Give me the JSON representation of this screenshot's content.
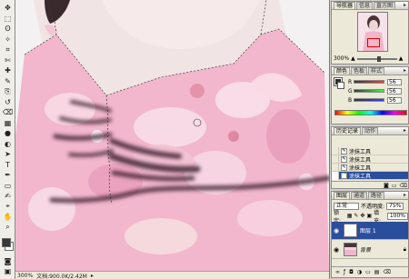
{
  "colors": {
    "panel_bg": "#ece9d8",
    "selection_blue": "#2a4d9c",
    "dress_pink": "#f2b7cc",
    "stroke_dark": "#3f2432"
  },
  "tools": [
    "move-tool",
    "marquee-tool",
    "lasso-tool",
    "magic-wand-tool",
    "crop-tool",
    "slice-tool",
    "healing-brush-tool",
    "brush-tool",
    "clone-stamp-tool",
    "history-brush-tool",
    "eraser-tool",
    "gradient-tool",
    "blur-tool",
    "dodge-tool",
    "path-selection-tool",
    "type-tool",
    "pen-tool",
    "shape-tool",
    "notes-tool",
    "eyedropper-tool",
    "hand-tool",
    "zoom-tool"
  ],
  "tool_glyphs": [
    "✥",
    "⬚",
    "ʘ",
    "✧",
    "⌗",
    "✄",
    "✚",
    "✎",
    "⎘",
    "↺",
    "⌫",
    "▦",
    "●",
    "◐",
    "➤",
    "T",
    "✒",
    "▭",
    "✍",
    "⌖",
    "✋",
    "⌕"
  ],
  "navigator": {
    "tabs": [
      "导航器",
      "信息",
      "直方图"
    ],
    "zoom": "300%"
  },
  "color_panel": {
    "tabs": [
      "颜色",
      "色板",
      "样式"
    ],
    "rows": [
      {
        "label": "R",
        "value": "56"
      },
      {
        "label": "G",
        "value": "56"
      },
      {
        "label": "B",
        "value": "56"
      }
    ]
  },
  "history": {
    "tabs": [
      "历史记录",
      "动作"
    ],
    "items": [
      "涂抹工具",
      "涂抹工具",
      "涂抹工具",
      "涂抹工具"
    ]
  },
  "layers": {
    "tabs": [
      "图层",
      "通道",
      "路径"
    ],
    "blend_mode": "正常",
    "opacity_label": "不透明度:",
    "opacity": "75%",
    "lock_label": "锁定:",
    "fill_label": "填充:",
    "fill": "100%",
    "items": [
      {
        "name": "图层 1",
        "active": true
      },
      {
        "name": "背景",
        "active": false
      }
    ]
  },
  "status": {
    "zoom": "300%",
    "doc": "文档:900.0K/2.42M"
  }
}
